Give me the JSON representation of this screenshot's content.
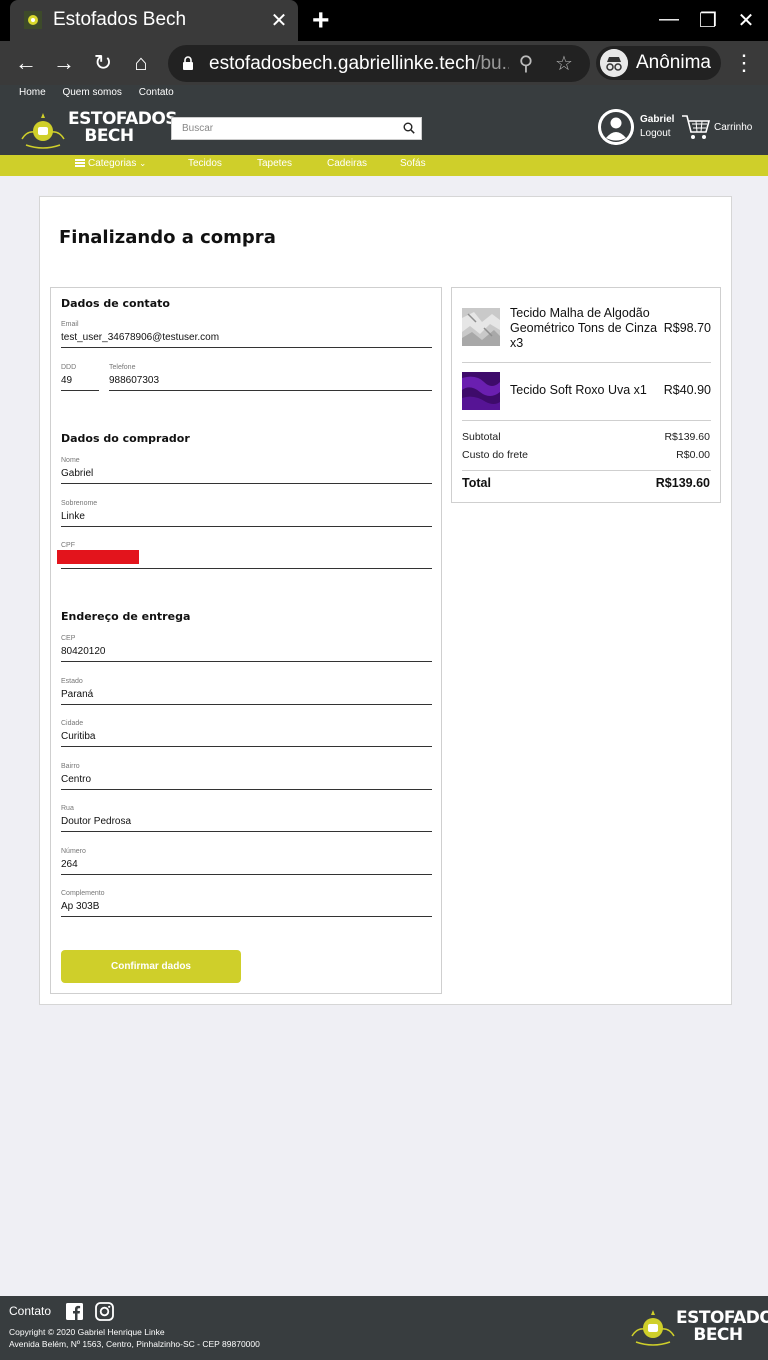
{
  "browser": {
    "tab_title": "Estofados Bech",
    "url_host": "estofadosbech.gabriellinke.tech",
    "url_path": "/bu...",
    "incognito_label": "Anônima"
  },
  "site": {
    "topnav": [
      "Home",
      "Quem somos",
      "Contato"
    ],
    "logo_line1": "ESTOFADOS",
    "logo_line2": "BECH",
    "search_placeholder": "Buscar",
    "user_name": "Gabriel",
    "logout_label": "Logout",
    "cart_label": "Carrinho",
    "categories_label": "Categorias",
    "categories": [
      "Tecidos",
      "Tapetes",
      "Cadeiras",
      "Sofás"
    ],
    "accent_color": "#cfcf2a",
    "header_color": "#383d3f"
  },
  "checkout": {
    "title": "Finalizando a compra",
    "contact": {
      "section_title": "Dados de contato",
      "email_label": "Email",
      "email": "test_user_34678906@testuser.com",
      "ddd_label": "DDD",
      "ddd": "49",
      "phone_label": "Telefone",
      "phone": "988607303"
    },
    "buyer": {
      "section_title": "Dados do comprador",
      "first_name_label": "Nome",
      "first_name": "Gabriel",
      "last_name_label": "Sobrenome",
      "last_name": "Linke",
      "cpf_label": "CPF"
    },
    "address": {
      "section_title": "Endereço de entrega",
      "cep_label": "CEP",
      "cep": "80420120",
      "state_label": "Estado",
      "state": "Paraná",
      "city_label": "Cidade",
      "city": "Curitiba",
      "district_label": "Bairro",
      "district": "Centro",
      "street_label": "Rua",
      "street": "Doutor Pedrosa",
      "number_label": "Número",
      "number": "264",
      "complement_label": "Complemento",
      "complement": "Ap 303B"
    },
    "confirm_button": "Confirmar dados"
  },
  "summary": {
    "items": [
      {
        "name": "Tecido Malha de Algodão Geométrico Tons de Cinza x3",
        "price": "R$98.70"
      },
      {
        "name": "Tecido Soft Roxo Uva x1",
        "price": "R$40.90"
      }
    ],
    "subtotal_label": "Subtotal",
    "subtotal": "R$139.60",
    "shipping_label": "Custo do frete",
    "shipping": "R$0.00",
    "total_label": "Total",
    "total": "R$139.60"
  },
  "footer": {
    "contact_label": "Contato",
    "copyright": "Copyright © 2020 Gabriel Henrique Linke",
    "address": "Avenida Belém, Nº 1563, Centro, Pinhalzinho-SC - CEP 89870000",
    "logo_line1": "ESTOFADOS",
    "logo_line2": "BECH"
  }
}
